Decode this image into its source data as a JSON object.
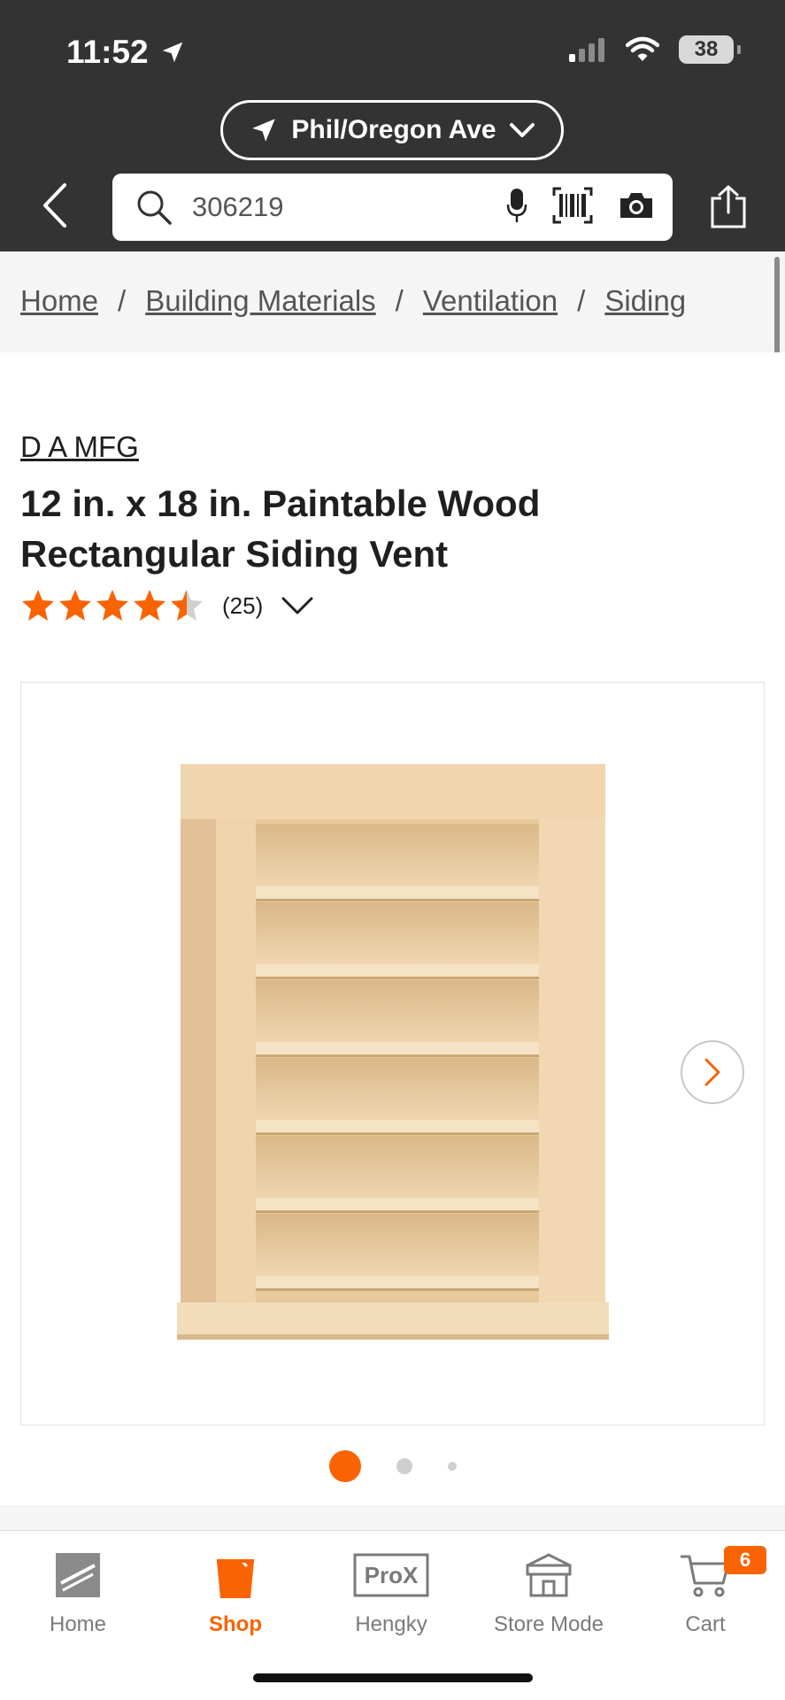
{
  "status_bar": {
    "time": "11:52",
    "battery": "38"
  },
  "store_selector": {
    "label": "Phil/Oregon Ave"
  },
  "search": {
    "value": "306219"
  },
  "breadcrumb": [
    {
      "label": "Home"
    },
    {
      "label": "Building Materials"
    },
    {
      "label": "Ventilation"
    },
    {
      "label": "Siding"
    }
  ],
  "product": {
    "brand": "D A MFG",
    "title": "12 in. x 18 in. Paintable Wood Rectangular Siding Vent",
    "rating": 4.5,
    "rating_max": 5,
    "review_count": "(25)",
    "gallery": {
      "image_count": 3,
      "active_index": 0
    }
  },
  "colors": {
    "accent": "#f96302",
    "header_bg": "#333333",
    "star": "#f96302"
  },
  "bottom_nav": [
    {
      "label": "Home",
      "icon": "home-depot-logo-icon"
    },
    {
      "label": "Shop",
      "icon": "bucket-icon"
    },
    {
      "label": "Hengky",
      "icon": "pro-x-icon"
    },
    {
      "label": "Store Mode",
      "icon": "storefront-icon"
    },
    {
      "label": "Cart",
      "icon": "cart-icon"
    }
  ],
  "cart_count": "6"
}
